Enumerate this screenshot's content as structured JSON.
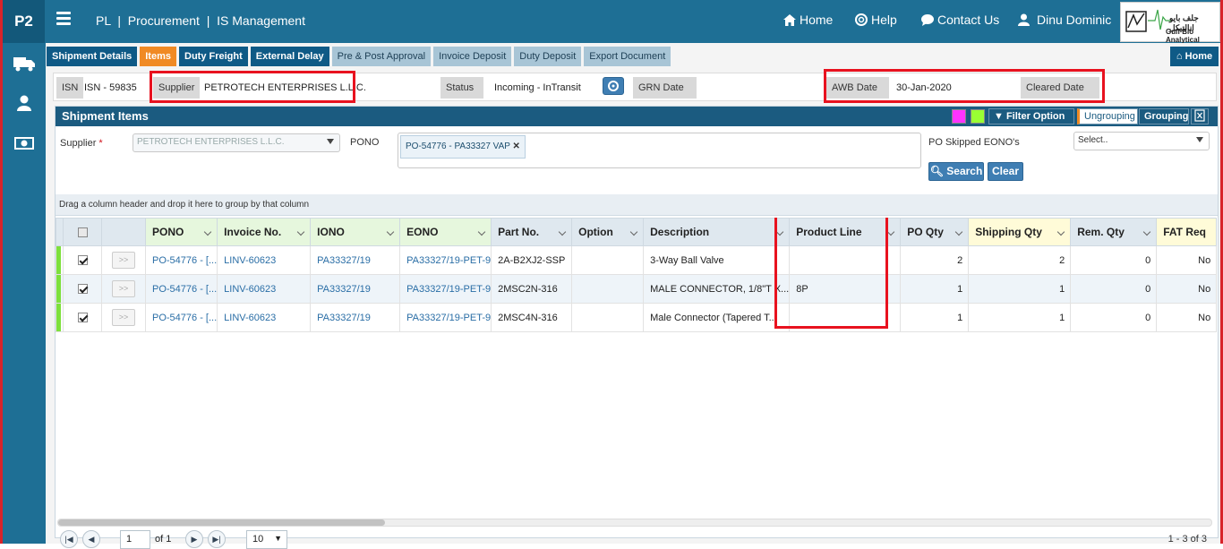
{
  "app": {
    "logo": "P2",
    "breadcrumb": "PL  |  Procurement  |  IS Management"
  },
  "topnav": {
    "home": "Home",
    "help": "Help",
    "contact": "Contact Us",
    "user": "Dinu Dominic"
  },
  "brand": {
    "line1": "جلف بايو انالتيكل",
    "line2": "Gulf Bio Analytical"
  },
  "tabs": [
    {
      "label": "Shipment Details"
    },
    {
      "label": "Items"
    },
    {
      "label": "Duty Freight"
    },
    {
      "label": "External Delay"
    },
    {
      "label": "Pre & Post Approval"
    },
    {
      "label": "Invoice Deposit"
    },
    {
      "label": "Duty Deposit"
    },
    {
      "label": "Export Document"
    }
  ],
  "home_button": "Home",
  "info": {
    "isn_label": "ISN",
    "isn_value": "ISN - 59835",
    "supplier_label": "Supplier",
    "supplier_value": "PETROTECH ENTERPRISES L.L.C.",
    "status_label": "Status",
    "status_value": "Incoming - InTransit",
    "grn_label": "GRN Date",
    "awb_label": "AWB Date",
    "awb_value": "30-Jan-2020",
    "cleared_label": "Cleared Date"
  },
  "panel": {
    "title": "Shipment Items",
    "filter_option": "Filter Option",
    "ungrouping": "Ungrouping",
    "grouping": "Grouping",
    "swatch_colors": [
      "#ff33ff",
      "#99ff33"
    ]
  },
  "filters": {
    "supplier_label": "Supplier",
    "required_mark": "*",
    "supplier_value": "PETROTECH ENTERPRISES L.L.C.",
    "pono_label": "PONO",
    "pono_tag": "PO-54776 - PA33327 VAP",
    "skipped_label": "PO Skipped EONO's",
    "skipped_select": "Select..",
    "search": "Search",
    "clear": "Clear"
  },
  "grid": {
    "group_hint": "Drag a column header and drop it here to group by that column",
    "columns": [
      "PONO",
      "Invoice No.",
      "IONO",
      "EONO",
      "Part No.",
      "Option",
      "Description",
      "Product Line",
      "PO Qty",
      "Shipping Qty",
      "Rem. Qty",
      "FAT Req"
    ],
    "rows": [
      {
        "pono": "PO-54776 - [...",
        "invoice": "LINV-60623",
        "iono": "PA33327/19",
        "eono": "PA33327/19-PET-9",
        "part": "2A-B2XJ2-SSP",
        "option": "",
        "description": "3-Way Ball Valve",
        "product_line": "",
        "po_qty": "2",
        "ship_qty": "2",
        "rem_qty": "0",
        "fat": "No"
      },
      {
        "pono": "PO-54776 - [...",
        "invoice": "LINV-60623",
        "iono": "PA33327/19",
        "eono": "PA33327/19-PET-9",
        "part": "2MSC2N-316",
        "option": "",
        "description": "MALE CONNECTOR, 1/8\"T X...",
        "product_line": "8P",
        "po_qty": "1",
        "ship_qty": "1",
        "rem_qty": "0",
        "fat": "No"
      },
      {
        "pono": "PO-54776 - [...",
        "invoice": "LINV-60623",
        "iono": "PA33327/19",
        "eono": "PA33327/19-PET-9",
        "part": "2MSC4N-316",
        "option": "",
        "description": "Male Connector (Tapered T...",
        "product_line": "",
        "po_qty": "1",
        "ship_qty": "1",
        "rem_qty": "0",
        "fat": "No"
      }
    ]
  },
  "pager": {
    "page": "1",
    "of": "of 1",
    "page_size": "10",
    "summary": "1 - 3 of 3"
  }
}
